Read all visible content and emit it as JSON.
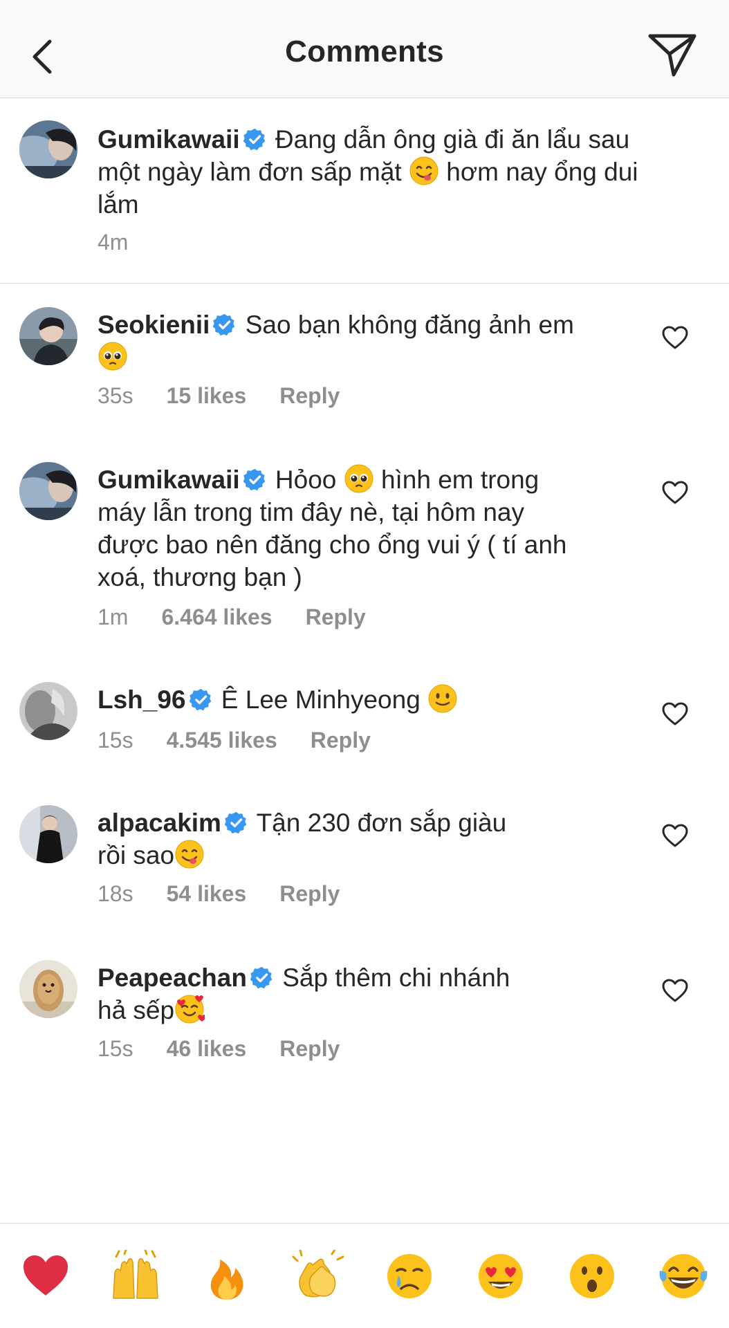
{
  "header": {
    "title": "Comments"
  },
  "caption": {
    "user": "Gumikawaii",
    "text_before": "Đang dẫn ông già đi ăn lẩu sau",
    "text_line2a": "một ngày làm đơn sấp mặt",
    "text_line2b": "hơm nay ổng dui",
    "text_line3": "lắm",
    "emoji": "yum-face",
    "time": "4m"
  },
  "comments": [
    {
      "user": "Seokienii",
      "l1": "Sao bạn không đăng ảnh em",
      "emoji": "pleading-face",
      "time": "35s",
      "likes": "15 likes",
      "reply": "Reply"
    },
    {
      "user": "Gumikawaii",
      "l1a": "Hỏoo",
      "l1b": "hình em trong",
      "l2": "máy lẫn trong tim đây nè, tại hôm nay",
      "l3": "được bao nên đăng cho ổng vui ý ( tí anh",
      "l4": "xoá, thương bạn )",
      "emoji": "pleading-face",
      "time": "1m",
      "likes": "6.464 likes",
      "reply": "Reply"
    },
    {
      "user": "Lsh_96",
      "l1": "Ê Lee Minhyeong",
      "emoji": "slight-smile",
      "time": "15s",
      "likes": "4.545 likes",
      "reply": "Reply"
    },
    {
      "user": "alpacakim",
      "l1": "Tận 230 đơn sắp giàu",
      "l2": "rồi sao",
      "emoji": "yum-face",
      "time": "18s",
      "likes": "54 likes",
      "reply": "Reply"
    },
    {
      "user": "Peapeachan",
      "l1": "Sắp thêm chi nhánh",
      "l2": "hả sếp",
      "emoji": "smiling-hearts-face",
      "time": "15s",
      "likes": "46 likes",
      "reply": "Reply"
    }
  ],
  "quick_reactions": [
    "red-heart",
    "raising-hands",
    "fire",
    "clapping-hands",
    "crying-face",
    "heart-eyes",
    "surprised-face",
    "tears-of-joy"
  ],
  "colors": {
    "text": "#262626",
    "meta": "#8e8e8e",
    "verified": "#3897f0",
    "divider": "#dbdbdb"
  }
}
